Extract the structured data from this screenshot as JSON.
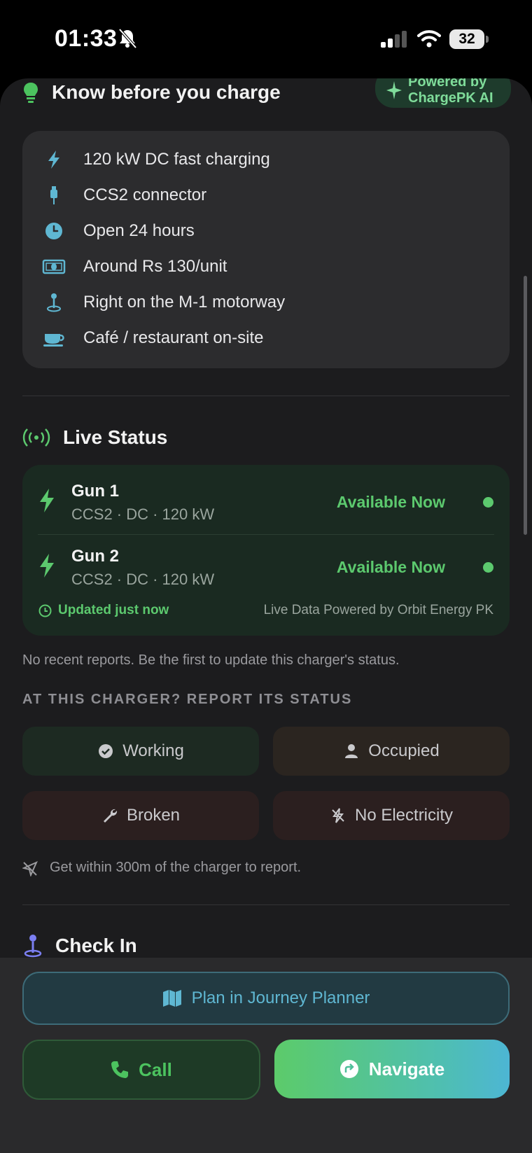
{
  "status_bar": {
    "time": "01:33",
    "battery": "32"
  },
  "know": {
    "title": "Know before you charge",
    "ai_badge_line1": "Powered by",
    "ai_badge_line2": "ChargePK AI",
    "facts": [
      {
        "icon": "bolt-icon",
        "text": "120 kW DC fast charging"
      },
      {
        "icon": "plug-icon",
        "text": "CCS2 connector"
      },
      {
        "icon": "clock-icon",
        "text": "Open 24 hours"
      },
      {
        "icon": "banknote-icon",
        "text": "Around Rs 130/unit"
      },
      {
        "icon": "location-pin-icon",
        "text": "Right on the M-1 motorway"
      },
      {
        "icon": "coffee-cup-icon",
        "text": "Café / restaurant on-site"
      }
    ]
  },
  "live": {
    "title": "Live Status",
    "guns": [
      {
        "name": "Gun 1",
        "spec": "CCS2 · DC · 120 kW",
        "status": "Available Now"
      },
      {
        "name": "Gun 2",
        "spec": "CCS2 · DC · 120 kW",
        "status": "Available Now"
      }
    ],
    "updated": "Updated just now",
    "source": "Live Data Powered by Orbit Energy PK"
  },
  "reports": {
    "empty_text": "No recent reports. Be the first to update this charger's status.",
    "heading": "AT THIS CHARGER? REPORT ITS STATUS",
    "buttons": {
      "working": "Working",
      "occupied": "Occupied",
      "broken": "Broken",
      "no_electricity": "No Electricity"
    },
    "proximity_note": "Get within 300m of the charger to report."
  },
  "checkin": {
    "title": "Check In"
  },
  "actions": {
    "plan": "Plan in Journey Planner",
    "call": "Call",
    "navigate": "Navigate"
  },
  "colors": {
    "accent_green": "#5cc96e",
    "accent_blue": "#5fb7d2",
    "background": "#1c1c1e"
  }
}
